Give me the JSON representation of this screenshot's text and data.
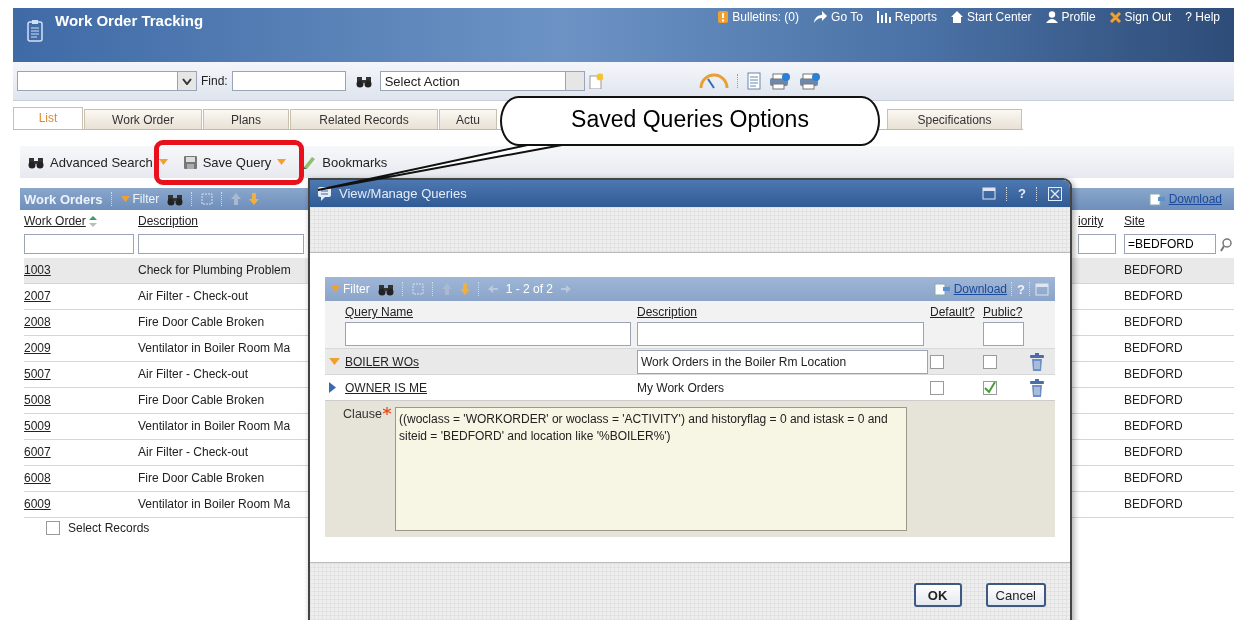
{
  "app": {
    "title": "Work Order Tracking",
    "nav": [
      {
        "kind": "bulletin",
        "label": "Bulletins: (0)"
      },
      {
        "kind": "goto",
        "label": "Go To"
      },
      {
        "kind": "reports",
        "label": "Reports"
      },
      {
        "kind": "home",
        "label": "Start Center"
      },
      {
        "kind": "profile",
        "label": "Profile"
      },
      {
        "kind": "signout",
        "label": "Sign Out"
      },
      {
        "kind": "help",
        "label": "? Help"
      }
    ]
  },
  "toolbar": {
    "find_label": "Find:",
    "action": "Select Action"
  },
  "tabs": [
    {
      "label": "List",
      "selected": true
    },
    {
      "label": "Work Order",
      "selected": false
    },
    {
      "label": "Plans",
      "selected": false
    },
    {
      "label": "Related Records",
      "selected": false
    },
    {
      "label": "Actu",
      "selected": false
    },
    {
      "label": "Specifications",
      "selected": false
    }
  ],
  "actions": [
    {
      "kind": "search",
      "label": "Advanced Search",
      "menu": true,
      "highlighted": false
    },
    {
      "kind": "save",
      "label": "Save Query",
      "menu": true,
      "highlighted": true
    },
    {
      "kind": "bookmark",
      "label": "Bookmarks",
      "menu": false,
      "highlighted": false
    }
  ],
  "work_orders": {
    "title": "Work Orders",
    "filter_label": "Filter",
    "download": "Download",
    "columns": [
      "Work Order",
      "Description",
      "iority",
      "Site"
    ],
    "site_filter": "=BEDFORD",
    "rows": [
      {
        "work_order": "1003",
        "description": "Check for Plumbing Problem",
        "site": "BEDFORD",
        "selected": true
      },
      {
        "work_order": "2007",
        "description": "Air Filter - Check-out",
        "site": "BEDFORD",
        "selected": false
      },
      {
        "work_order": "2008",
        "description": "Fire Door Cable Broken",
        "site": "BEDFORD",
        "selected": false
      },
      {
        "work_order": "2009",
        "description": "Ventilator in Boiler Room Ma",
        "site": "BEDFORD",
        "selected": false
      },
      {
        "work_order": "5007",
        "description": "Air Filter - Check-out",
        "site": "BEDFORD",
        "selected": false
      },
      {
        "work_order": "5008",
        "description": "Fire Door Cable Broken",
        "site": "BEDFORD",
        "selected": false
      },
      {
        "work_order": "5009",
        "description": "Ventilator in Boiler Room Ma",
        "site": "BEDFORD",
        "selected": false
      },
      {
        "work_order": "6007",
        "description": "Air Filter - Check-out",
        "site": "BEDFORD",
        "selected": false
      },
      {
        "work_order": "6008",
        "description": "Fire Door Cable Broken",
        "site": "BEDFORD",
        "selected": false
      },
      {
        "work_order": "6009",
        "description": "Ventilator in Boiler Room Ma",
        "site": "BEDFORD",
        "selected": false
      }
    ]
  },
  "select_records": {
    "label": "Select Records",
    "checked": false
  },
  "dialog": {
    "title": "View/Manage Queries",
    "help": "?",
    "filter_label": "Filter",
    "paging": "1 - 2 of 2",
    "download": "Download",
    "columns": [
      "Query Name",
      "Description",
      "Default?",
      "Public?"
    ],
    "rows": [
      {
        "name": "BOILER WOs",
        "description": "Work Orders in the Boiler Rm Location",
        "default": false,
        "public": false,
        "expanded": true,
        "selected": true
      },
      {
        "name": "OWNER IS ME",
        "description": "My Work Orders",
        "default": false,
        "public": true,
        "expanded": false,
        "selected": false
      }
    ],
    "clause_label": "Clause",
    "clause": "((woclass = 'WORKORDER' or woclass = 'ACTIVITY') and historyflag = 0 and istask = 0 and siteid = 'BEDFORD' and location like '%BOILER%')",
    "buttons": [
      "OK",
      "Cancel"
    ]
  },
  "callout": "Saved Queries Options"
}
